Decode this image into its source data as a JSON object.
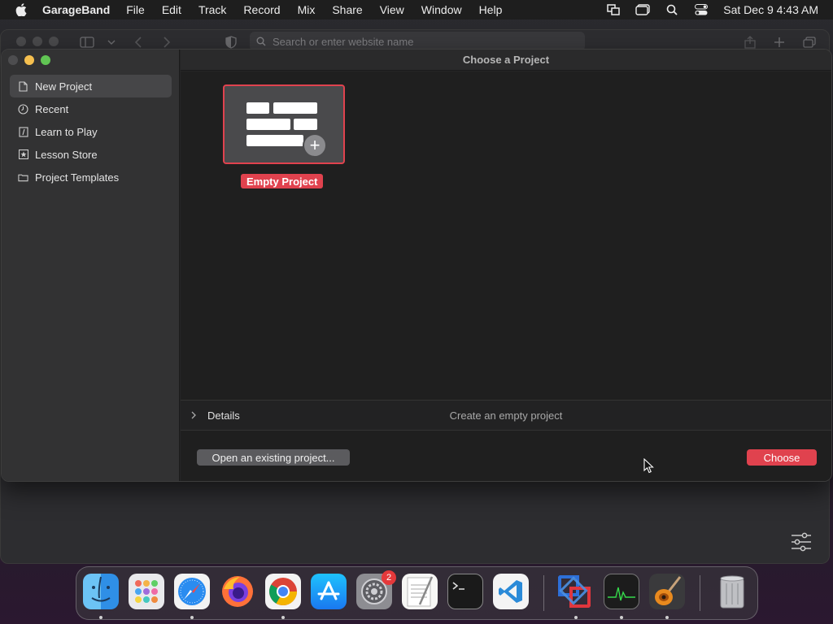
{
  "menubar": {
    "app_name": "GarageBand",
    "menus": [
      "File",
      "Edit",
      "Track",
      "Record",
      "Mix",
      "Share",
      "View",
      "Window",
      "Help"
    ],
    "clock": "Sat Dec 9  4:43 AM"
  },
  "browser": {
    "url_placeholder": "Search or enter website name"
  },
  "dialog": {
    "title": "Choose a Project",
    "sidebar": [
      {
        "label": "New Project",
        "icon": "document-icon",
        "selected": true
      },
      {
        "label": "Recent",
        "icon": "clock-icon",
        "selected": false
      },
      {
        "label": "Learn to Play",
        "icon": "music-note-icon",
        "selected": false
      },
      {
        "label": "Lesson Store",
        "icon": "star-icon",
        "selected": false
      },
      {
        "label": "Project Templates",
        "icon": "folder-icon",
        "selected": false
      }
    ],
    "template": {
      "label": "Empty Project"
    },
    "details_label": "Details",
    "details_description": "Create an empty project",
    "open_button": "Open an existing project...",
    "choose_button": "Choose"
  },
  "dock": {
    "apps": [
      {
        "name": "Finder",
        "icon": "finder-icon"
      },
      {
        "name": "Launchpad",
        "icon": "launchpad-icon"
      },
      {
        "name": "Safari",
        "icon": "safari-icon"
      },
      {
        "name": "Firefox",
        "icon": "firefox-icon"
      },
      {
        "name": "Chrome",
        "icon": "chrome-icon"
      },
      {
        "name": "App Store",
        "icon": "app-store-icon"
      },
      {
        "name": "System Settings",
        "icon": "settings-icon",
        "badge": "2"
      },
      {
        "name": "TextEdit",
        "icon": "textedit-icon"
      },
      {
        "name": "Terminal",
        "icon": "terminal-icon"
      },
      {
        "name": "VS Code",
        "icon": "vscode-icon"
      },
      {
        "name": "Parallels",
        "icon": "parallels-icon"
      },
      {
        "name": "Activity Monitor",
        "icon": "activity-monitor-icon"
      },
      {
        "name": "GarageBand",
        "icon": "garageband-icon"
      },
      {
        "name": "Trash",
        "icon": "trash-icon"
      }
    ]
  },
  "colors": {
    "accent": "#e0424e",
    "selected_row": "#464648",
    "dialog_bg": "#1f1f1f"
  }
}
